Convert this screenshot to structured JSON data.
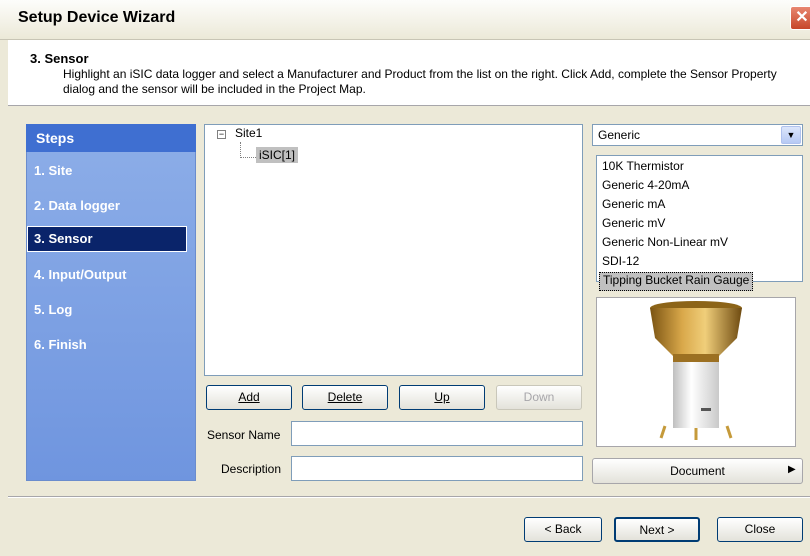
{
  "window": {
    "title": "Setup Device Wizard",
    "close_glyph": "✕"
  },
  "header": {
    "title": "3. Sensor",
    "description": "Highlight an iSIC data logger and select a Manufacturer and Product from the list on the right. Click Add, complete the Sensor Property dialog and the sensor will be included in the Project Map."
  },
  "steps": {
    "heading": "Steps",
    "items": [
      "1. Site",
      "2. Data logger",
      "3. Sensor",
      "4. Input/Output",
      "5. Log",
      "6. Finish"
    ],
    "active_index": 2
  },
  "tree": {
    "root": "Site1",
    "root_expander": "−",
    "child": "iSIC[1]"
  },
  "buttons": {
    "add": "Add",
    "delete": "Delete",
    "up": "Up",
    "down": "Down",
    "document": "Document",
    "back": "< Back",
    "next": "Next >",
    "close": "Close"
  },
  "fields": {
    "sensor_name_label": "Sensor Name",
    "sensor_name_value": "",
    "description_label": "Description",
    "description_value": ""
  },
  "manufacturer": {
    "selected": "Generic"
  },
  "products": {
    "items": [
      "10K Thermistor",
      "Generic 4-20mA",
      "Generic mA",
      "Generic mV",
      "Generic Non-Linear mV",
      "SDI-12",
      "Tipping Bucket Rain Gauge"
    ],
    "selected_index": 6
  },
  "icons": {
    "dropdown": "chevron-down-icon",
    "document_arrow": "triangle-right-icon"
  }
}
